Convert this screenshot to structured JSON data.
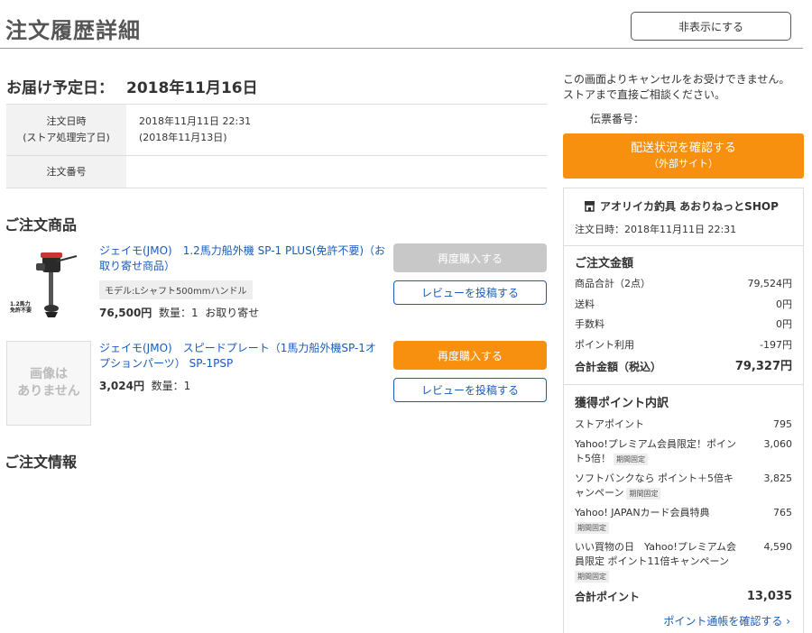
{
  "header": {
    "title": "注文履歴詳細",
    "hide_button": "非表示にする"
  },
  "delivery": {
    "label": "お届け予定日：",
    "date": "2018年11月16日"
  },
  "order_info": {
    "datetime_label_1": "注文日時",
    "datetime_label_2": "(ストア処理完了日)",
    "datetime_value": "2018年11月11日 22:31",
    "processed_value": "(2018年11月13日)",
    "order_number_label": "注文番号",
    "order_number_value": ""
  },
  "products": {
    "title": "ご注文商品",
    "items": [
      {
        "name": "ジェイモ(JMO)　1.2馬力船外機 SP-1 PLUS(免許不要)（お取り寄せ商品）",
        "variant": "モデル:Lシャフト500mmハンドル",
        "price": "76,500円",
        "quantity": "数量：1",
        "note": "お取り寄せ",
        "image_caption_1": "1.2馬力",
        "image_caption_2": "免許不要",
        "rebuy": "再度購入する",
        "review": "レビューを投稿する"
      },
      {
        "name": "ジェイモ(JMO)　スピードプレート（1馬力船外機SP-1オプションパーツ） SP-1PSP",
        "price": "3,024円",
        "quantity": "数量：1",
        "no_image_1": "画像は",
        "no_image_2": "ありません",
        "rebuy": "再度購入する",
        "review": "レビューを投稿する"
      }
    ]
  },
  "order_details": {
    "title": "ご注文情報"
  },
  "side": {
    "cancel_note_1": "この画面よりキャンセルをお受けできません。",
    "cancel_note_2": "ストアまで直接ご相談ください。",
    "slip_label": "伝票番号：",
    "ship_button": "配送状況を確認する",
    "ship_button_sub": "（外部サイト）"
  },
  "summary": {
    "store": "アオリイカ釣具 あおりねっとSHOP",
    "order_date": "注文日時：2018年11月11日 22:31",
    "amount_title": "ご注文金額",
    "lines": [
      {
        "label": "商品合計（2点）",
        "value": "79,524円"
      },
      {
        "label": "送料",
        "value": "0円"
      },
      {
        "label": "手数料",
        "value": "0円"
      },
      {
        "label": "ポイント利用",
        "value": "-197円"
      }
    ],
    "total_label": "合計金額（税込）",
    "total_value": "79,327円",
    "points_title": "獲得ポイント内訳",
    "points": [
      {
        "label": "ストアポイント",
        "value": "795"
      },
      {
        "label": "Yahoo!プレミアム会員限定！ポイント5倍！",
        "tag": "期間固定",
        "value": "3,060"
      },
      {
        "label": "ソフトバンクなら ポイント＋5倍キャンペーン",
        "tag": "期間固定",
        "value": "3,825"
      },
      {
        "label": "Yahoo! JAPANカード会員特典",
        "tag": "期間固定",
        "value": "765"
      },
      {
        "label": "いい買物の日　Yahoo!プレミアム会員限定 ポイント11倍キャンペーン",
        "tag": "期間固定",
        "value": "4,590"
      }
    ],
    "points_total_label": "合計ポイント",
    "points_total_value": "13,035",
    "points_link": "ポイント通帳を確認する ›"
  },
  "colors": {
    "accent": "#f7900e",
    "link": "#1a5bb8",
    "disabled": "#c8c8c8"
  }
}
